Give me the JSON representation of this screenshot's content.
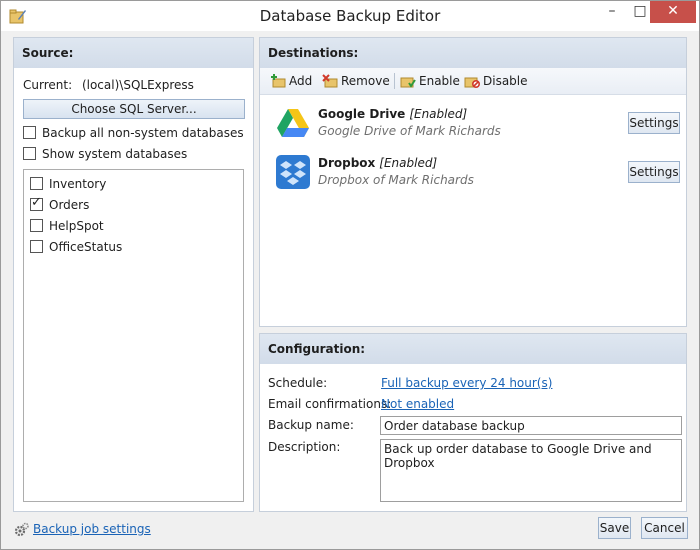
{
  "window": {
    "title": "Database Backup Editor",
    "minimize": "–",
    "maximize": "□",
    "close": "✕"
  },
  "source": {
    "header": "Source:",
    "current_label": "Current:",
    "current_value": "(local)\\SQLExpress",
    "choose_button": "Choose SQL Server...",
    "backup_all_label": "Backup all non-system databases",
    "backup_all_checked": false,
    "show_system_label": "Show system databases",
    "show_system_checked": false,
    "databases": [
      {
        "name": "Inventory",
        "checked": false
      },
      {
        "name": "Orders",
        "checked": true
      },
      {
        "name": "HelpSpot",
        "checked": false
      },
      {
        "name": "OfficeStatus",
        "checked": false
      }
    ]
  },
  "destinations": {
    "header": "Destinations:",
    "toolbar": {
      "add": "Add",
      "remove": "Remove",
      "enable": "Enable",
      "disable": "Disable"
    },
    "items": [
      {
        "name": "Google Drive",
        "status": "[Enabled]",
        "description": "Google Drive of Mark Richards",
        "settings": "Settings",
        "icon": "google-drive-icon"
      },
      {
        "name": "Dropbox",
        "status": "[Enabled]",
        "description": "Dropbox of Mark Richards",
        "settings": "Settings",
        "icon": "dropbox-icon"
      }
    ]
  },
  "configuration": {
    "header": "Configuration:",
    "schedule_label": "Schedule:",
    "schedule_value": "Full backup every 24 hour(s)",
    "email_label": "Email confirmations:",
    "email_value": "Not enabled",
    "backup_name_label": "Backup name:",
    "backup_name_value": "Order database backup",
    "description_label": "Description:",
    "description_value": "Back up order database to Google Drive and Dropbox"
  },
  "footer": {
    "settings_link": "Backup job settings",
    "save": "Save",
    "cancel": "Cancel"
  },
  "colors": {
    "link": "#1a63b6",
    "panel_header": "#d8e1ec",
    "close_button": "#c7504a"
  }
}
